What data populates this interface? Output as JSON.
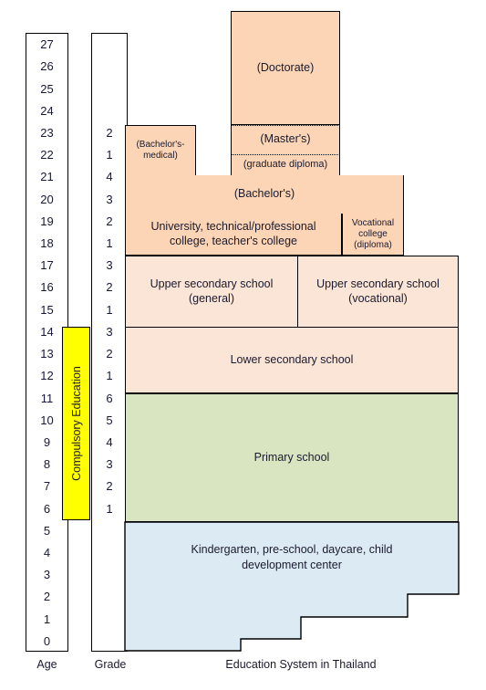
{
  "title": "Education System in Thailand",
  "footer": {
    "age_label": "Age",
    "grade_label": "Grade",
    "chart_title": "Education System in Thailand"
  },
  "compulsory": {
    "label": "Compulsory Education",
    "color": "#ffff00",
    "age_from": 6,
    "age_to": 14
  },
  "colors": {
    "tertiary": "#fbd5b5",
    "secondary": "#fbe5d6",
    "primary": "#d9e5c0",
    "preschool": "#dceaf3",
    "outline": "#000000",
    "compulsory": "#ffff00"
  },
  "axes": {
    "age_ticks": [
      27,
      26,
      25,
      24,
      23,
      22,
      21,
      20,
      19,
      18,
      17,
      16,
      15,
      14,
      13,
      12,
      11,
      10,
      9,
      8,
      7,
      6,
      5,
      4,
      3,
      2,
      1,
      0
    ],
    "grade_ticks": [
      {
        "value": 2,
        "age": 23
      },
      {
        "value": 1,
        "age": 22
      },
      {
        "value": 4,
        "age": 21
      },
      {
        "value": 3,
        "age": 20
      },
      {
        "value": 2,
        "age": 19
      },
      {
        "value": 1,
        "age": 18
      },
      {
        "value": 3,
        "age": 17
      },
      {
        "value": 2,
        "age": 16
      },
      {
        "value": 1,
        "age": 15
      },
      {
        "value": 3,
        "age": 14
      },
      {
        "value": 2,
        "age": 13
      },
      {
        "value": 1,
        "age": 12
      },
      {
        "value": 6,
        "age": 11
      },
      {
        "value": 5,
        "age": 10
      },
      {
        "value": 4,
        "age": 9
      },
      {
        "value": 3,
        "age": 8
      },
      {
        "value": 2,
        "age": 7
      },
      {
        "value": 1,
        "age": 6
      }
    ]
  },
  "blocks": {
    "doctorate": {
      "label": "(Doctorate)"
    },
    "masters": {
      "label": "(Master's)"
    },
    "grad_diploma": {
      "label": "(graduate diploma)"
    },
    "bachelor_med": {
      "label": "(Bachelor's-\nmedical)"
    },
    "bachelor": {
      "label": "(Bachelor's)"
    },
    "university": {
      "label": "University, technical/professional\ncollege, teacher's college"
    },
    "vocational_college": {
      "label": "Vocational\ncollege\n(diploma)"
    },
    "upper_general": {
      "label": "Upper secondary school\n(general)"
    },
    "upper_voc": {
      "label": "Upper secondary school\n(vocational)"
    },
    "lower": {
      "label": "Lower secondary school"
    },
    "primary": {
      "label": "Primary school"
    },
    "kindergarten": {
      "label": "Kindergarten, pre-school, daycare, child\ndevelopment center"
    }
  },
  "chart_data": {
    "type": "diagram",
    "title": "Education System in Thailand",
    "xlabel": "",
    "ylabel": "Age",
    "ylim": [
      0,
      28
    ],
    "secondary_axis": "Grade",
    "stages": [
      {
        "name": "Kindergarten, pre-school, daycare, child development center",
        "age_start": 0,
        "age_end": 6,
        "grades": [],
        "color": "#dceaf3"
      },
      {
        "name": "Primary school",
        "age_start": 6,
        "age_end": 12,
        "grades": [
          1,
          2,
          3,
          4,
          5,
          6
        ],
        "color": "#d9e5c0"
      },
      {
        "name": "Lower secondary school",
        "age_start": 12,
        "age_end": 15,
        "grades": [
          1,
          2,
          3
        ],
        "color": "#fbe5d6"
      },
      {
        "name": "Upper secondary school (general)",
        "age_start": 15,
        "age_end": 18,
        "grades": [
          1,
          2,
          3
        ],
        "color": "#fbe5d6"
      },
      {
        "name": "Upper secondary school (vocational)",
        "age_start": 15,
        "age_end": 18,
        "grades": [
          1,
          2,
          3
        ],
        "color": "#fbe5d6"
      },
      {
        "name": "University, technical/professional college, teacher's college",
        "age_start": 18,
        "age_end": 20,
        "grades": [
          1,
          2
        ],
        "color": "#fbd5b5"
      },
      {
        "name": "Vocational college (diploma)",
        "age_start": 18,
        "age_end": 20,
        "grades": [
          1,
          2
        ],
        "color": "#fbd5b5"
      },
      {
        "name": "(Bachelor's)",
        "age_start": 18,
        "age_end": 22,
        "grades": [
          1,
          2,
          3,
          4
        ],
        "color": "#fbd5b5"
      },
      {
        "name": "(Bachelor's-medical)",
        "age_start": 18,
        "age_end": 24,
        "grades": [],
        "color": "#fbd5b5"
      },
      {
        "name": "(graduate diploma)",
        "age_start": 22,
        "age_end": 23,
        "grades": [
          1
        ],
        "color": "#fbd5b5"
      },
      {
        "name": "(Master's)",
        "age_start": 22,
        "age_end": 24,
        "grades": [
          1,
          2
        ],
        "color": "#fbd5b5"
      },
      {
        "name": "(Doctorate)",
        "age_start": 24,
        "age_end": 28,
        "grades": [],
        "color": "#fbd5b5"
      }
    ],
    "compulsory_education": {
      "age_start": 6,
      "age_end": 15
    }
  }
}
